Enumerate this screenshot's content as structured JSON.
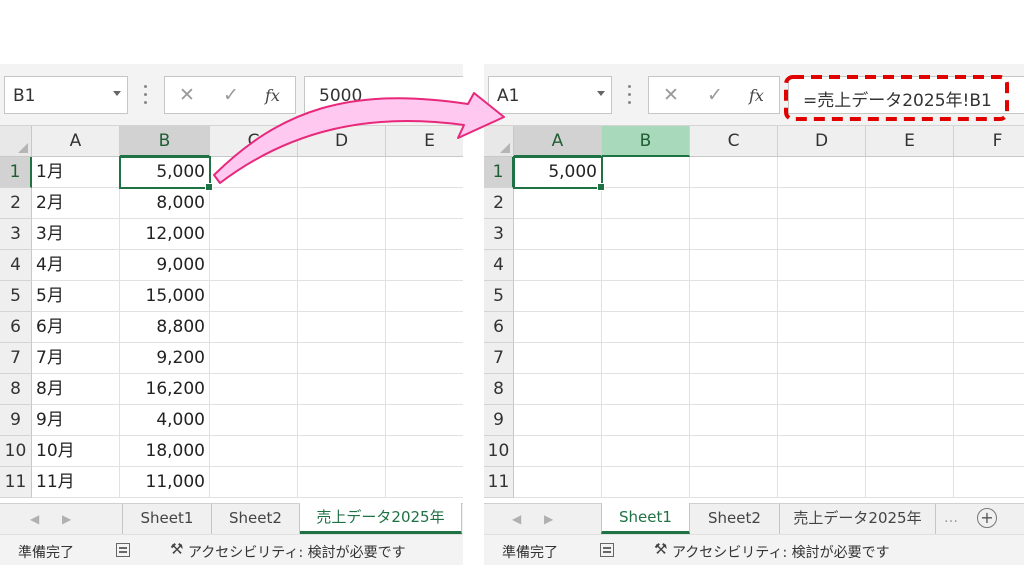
{
  "left": {
    "name_box": "B1",
    "formula": "5000",
    "columns": [
      "A",
      "B",
      "C",
      "D",
      "E"
    ],
    "rows": [
      {
        "n": "1",
        "a": "1月",
        "b": "5,000"
      },
      {
        "n": "2",
        "a": "2月",
        "b": "8,000"
      },
      {
        "n": "3",
        "a": "3月",
        "b": "12,000"
      },
      {
        "n": "4",
        "a": "4月",
        "b": "9,000"
      },
      {
        "n": "5",
        "a": "5月",
        "b": "15,000"
      },
      {
        "n": "6",
        "a": "6月",
        "b": "8,800"
      },
      {
        "n": "7",
        "a": "7月",
        "b": "9,200"
      },
      {
        "n": "8",
        "a": "8月",
        "b": "16,200"
      },
      {
        "n": "9",
        "a": "9月",
        "b": "4,000"
      },
      {
        "n": "10",
        "a": "10月",
        "b": "18,000"
      },
      {
        "n": "11",
        "a": "11月",
        "b": "11,000"
      }
    ],
    "tabs": [
      "Sheet1",
      "Sheet2",
      "売上データ2025年"
    ],
    "active_tab": "売上データ2025年"
  },
  "right": {
    "name_box": "A1",
    "formula": "=売上データ2025年!B1",
    "columns": [
      "A",
      "B",
      "C",
      "D",
      "E",
      "F"
    ],
    "rows": [
      "1",
      "2",
      "3",
      "4",
      "5",
      "6",
      "7",
      "8",
      "9",
      "10",
      "11"
    ],
    "a1_value": "5,000",
    "tabs": [
      "Sheet1",
      "Sheet2",
      "売上データ2025年"
    ],
    "active_tab": "Sheet1"
  },
  "status": {
    "ready": "準備完了",
    "accessibility": "アクセシビリティ: 検討が必要です"
  },
  "toolbar": {
    "cancel_glyph": "✕",
    "enter_glyph": "✓",
    "fx_glyph": "fx",
    "tab_prev": "◀",
    "tab_next": "▶",
    "tab_more": "…",
    "add_sheet": "+"
  },
  "colors": {
    "excel_green": "#1f7244",
    "arrow_fill": "#ffc8f0",
    "arrow_stroke": "#e8287a",
    "highlight_dash": "#e00000"
  }
}
